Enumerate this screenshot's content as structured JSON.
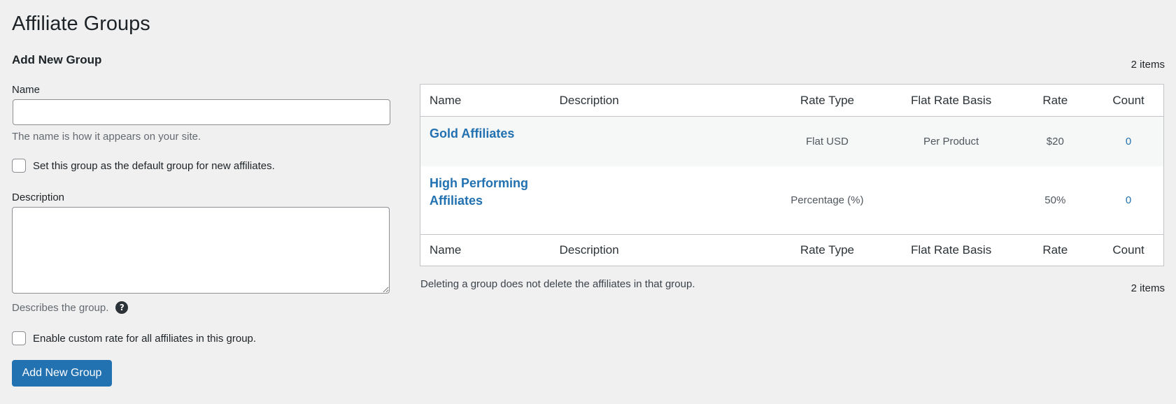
{
  "page": {
    "title": "Affiliate Groups",
    "add_section_title": "Add New Group"
  },
  "form": {
    "name_label": "Name",
    "name_value": "",
    "name_hint": "The name is how it appears on your site.",
    "default_checkbox_label": "Set this group as the default group for new affiliates.",
    "default_checked": false,
    "description_label": "Description",
    "description_value": "",
    "description_hint": "Describes the group.",
    "help_icon_glyph": "?",
    "custom_rate_checkbox_label": "Enable custom rate for all affiliates in this group.",
    "custom_rate_checked": false,
    "submit_label": "Add New Group"
  },
  "table": {
    "items_count_top": "2 items",
    "items_count_bottom": "2 items",
    "columns": {
      "name": "Name",
      "description": "Description",
      "rate_type": "Rate Type",
      "flat_rate_basis": "Flat Rate Basis",
      "rate": "Rate",
      "count": "Count"
    },
    "rows": [
      {
        "name": "Gold Affiliates",
        "description": "",
        "rate_type": "Flat USD",
        "flat_rate_basis": "Per Product",
        "rate": "$20",
        "count": "0"
      },
      {
        "name": "High Performing Affiliates",
        "description": "",
        "rate_type": "Percentage (%)",
        "flat_rate_basis": "",
        "rate": "50%",
        "count": "0"
      }
    ],
    "note": "Deleting a group does not delete the affiliates in that group."
  },
  "colors": {
    "accent": "#2271b1",
    "background": "#f0f0f1",
    "border": "#c3c4c7"
  },
  "icons": {
    "help": "question-circle-icon"
  }
}
